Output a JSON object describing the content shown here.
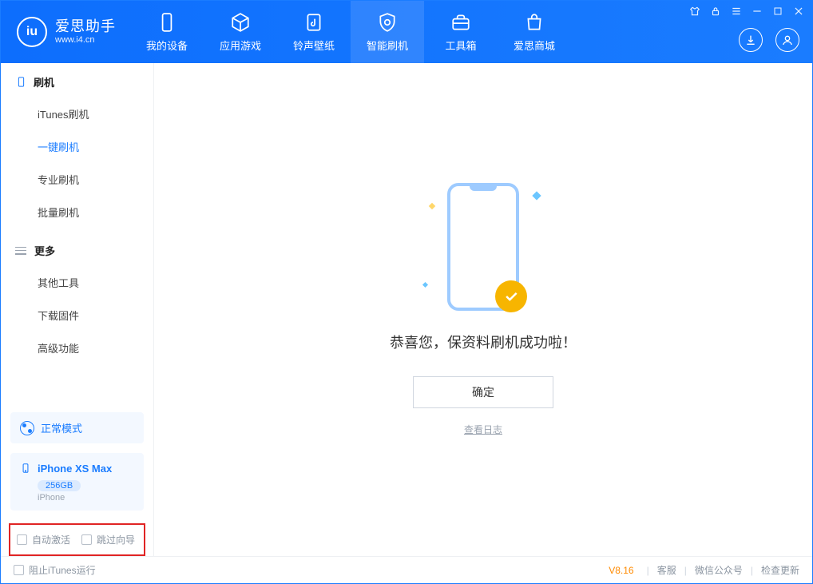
{
  "app": {
    "title": "爱思助手",
    "subtitle": "www.i4.cn"
  },
  "tabs": {
    "device": "我的设备",
    "apps": "应用游戏",
    "ring": "铃声壁纸",
    "flash": "智能刷机",
    "toolbox": "工具箱",
    "store": "爱思商城"
  },
  "sidebar": {
    "section_flash": "刷机",
    "items": {
      "itunes": "iTunes刷机",
      "oneclick": "一键刷机",
      "pro": "专业刷机",
      "batch": "批量刷机"
    },
    "section_more": "更多",
    "more": {
      "other": "其他工具",
      "firmware": "下载固件",
      "advanced": "高级功能"
    }
  },
  "mode": {
    "label": "正常模式"
  },
  "device": {
    "name": "iPhone XS Max",
    "capacity": "256GB",
    "type": "iPhone"
  },
  "options": {
    "auto_activate": "自动激活",
    "skip_guide": "跳过向导"
  },
  "result": {
    "message": "恭喜您，保资料刷机成功啦！",
    "ok": "确定",
    "viewlog": "查看日志"
  },
  "footer": {
    "block_itunes": "阻止iTunes运行",
    "version": "V8.16",
    "service": "客服",
    "wechat": "微信公众号",
    "update": "检查更新"
  }
}
